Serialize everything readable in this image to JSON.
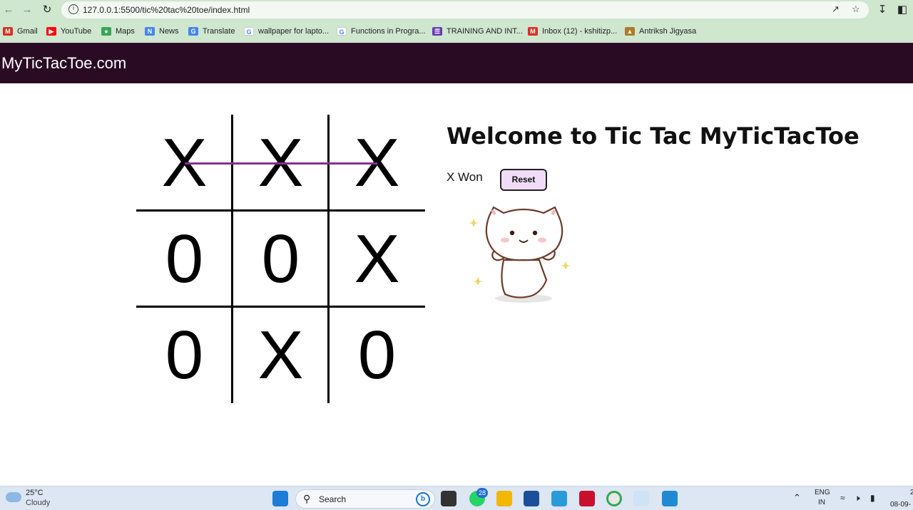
{
  "browser": {
    "url": "127.0.0.1:5500/tic%20tac%20toe/index.html",
    "bookmarks": [
      {
        "label": "Gmail",
        "icon": "gmail-icon",
        "color": "#d93025"
      },
      {
        "label": "YouTube",
        "icon": "youtube-icon",
        "color": "#ff0000"
      },
      {
        "label": "Maps",
        "icon": "maps-icon",
        "color": "#34a853"
      },
      {
        "label": "News",
        "icon": "news-icon",
        "color": "#4285f4"
      },
      {
        "label": "Translate",
        "icon": "translate-icon",
        "color": "#4285f4"
      },
      {
        "label": "wallpaper for lapto...",
        "icon": "google-icon",
        "color": "#4285f4"
      },
      {
        "label": "Functions in Progra...",
        "icon": "google-icon",
        "color": "#4285f4"
      },
      {
        "label": "TRAINING AND INT...",
        "icon": "forms-icon",
        "color": "#673ab7"
      },
      {
        "label": "Inbox (12) - kshitizp...",
        "icon": "gmail-icon",
        "color": "#d93025"
      },
      {
        "label": "Antriksh Jigyasa",
        "icon": "rocket-icon",
        "color": "#b07a2a"
      }
    ]
  },
  "site": {
    "brand": "MyTicTacToe.com",
    "title": "Welcome to Tic Tac MyTicTacToe",
    "status": "X Won",
    "reset_label": "Reset",
    "board": [
      "X",
      "X",
      "X",
      "0",
      "0",
      "X",
      "0",
      "X",
      "0"
    ],
    "win_line_color": "#8a2d95",
    "nav_color": "#2a0b24"
  },
  "taskbar": {
    "weather_temp": "25°C",
    "weather_desc": "Cloudy",
    "search_label": "Search",
    "whatsapp_badge": "28",
    "lang_top": "ENG",
    "lang_bottom": "IN",
    "date": "08-09-",
    "time_partial": "2"
  }
}
